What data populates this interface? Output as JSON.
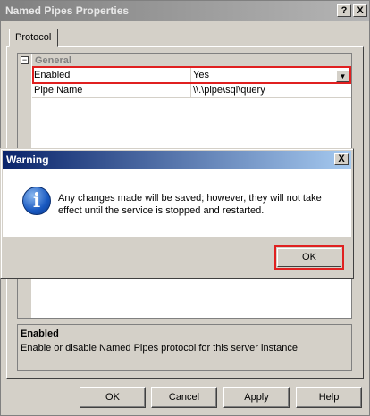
{
  "window": {
    "title": "Named Pipes Properties",
    "help_glyph": "?",
    "close_glyph": "X"
  },
  "tabs": [
    {
      "label": "Protocol"
    }
  ],
  "grid": {
    "collapse_glyph": "−",
    "group": "General",
    "rows": [
      {
        "name": "Enabled",
        "value": "Yes"
      },
      {
        "name": "Pipe Name",
        "value": "\\\\.\\pipe\\sql\\query"
      }
    ],
    "dropdown_glyph": "▼"
  },
  "description": {
    "title": "Enabled",
    "text": "Enable or disable Named Pipes protocol for this server instance"
  },
  "buttons": {
    "ok": "OK",
    "cancel": "Cancel",
    "apply": "Apply",
    "help": "Help"
  },
  "warning": {
    "title": "Warning",
    "close_glyph": "X",
    "icon_glyph": "i",
    "message": "Any changes made will be saved; however, they will not take effect until the service is stopped and restarted.",
    "ok": "OK"
  },
  "colors": {
    "highlight": "#e02020",
    "dialog_title_start": "#0a246a",
    "dialog_title_end": "#a6caf0"
  }
}
